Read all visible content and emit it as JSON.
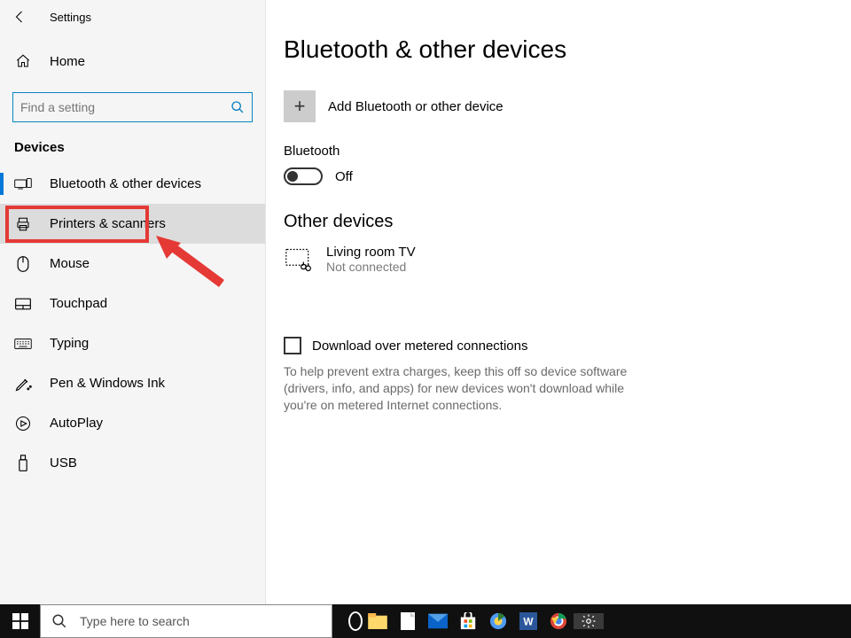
{
  "titlebar": {
    "title": "Settings"
  },
  "sidebar": {
    "home_label": "Home",
    "search_placeholder": "Find a setting",
    "category_label": "Devices",
    "items": [
      {
        "label": "Bluetooth & other devices",
        "selected": true
      },
      {
        "label": "Printers & scanners",
        "highlighted": true
      },
      {
        "label": "Mouse"
      },
      {
        "label": "Touchpad"
      },
      {
        "label": "Typing"
      },
      {
        "label": "Pen & Windows Ink"
      },
      {
        "label": "AutoPlay"
      },
      {
        "label": "USB"
      }
    ]
  },
  "main": {
    "page_title": "Bluetooth & other devices",
    "add_label": "Add Bluetooth or other device",
    "bluetooth_label": "Bluetooth",
    "bluetooth_state": "Off",
    "other_devices_header": "Other devices",
    "devices": [
      {
        "name": "Living room TV",
        "status": "Not connected"
      }
    ],
    "metered_checkbox_label": "Download over metered connections",
    "metered_checkbox_checked": false,
    "metered_help": "To help prevent extra charges, keep this off so device software (drivers, info, and apps) for new devices won't download while you're on metered Internet connections."
  },
  "taskbar": {
    "search_placeholder": "Type here to search"
  },
  "annotation": {
    "target": "Printers & scanners"
  }
}
